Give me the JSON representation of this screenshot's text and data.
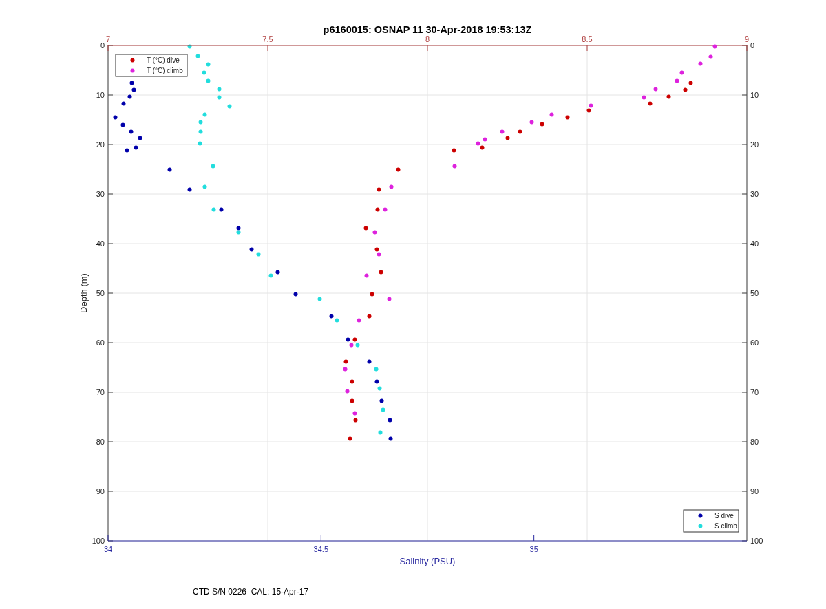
{
  "title": "p6160015: OSNAP 11 30-Apr-2018 19:53:13Z",
  "salinity_chart": {
    "chart_data": {
      "type": "scatter",
      "xlabel": "Salinity (PSU)",
      "ylabel": "Depth (m)",
      "xlim": [
        34,
        35.5
      ],
      "ylim": [
        100,
        0
      ],
      "legend": "lower right",
      "grid": true,
      "xticks": [
        34,
        34.5,
        35
      ],
      "yticks": [
        0,
        10,
        20,
        30,
        40,
        50,
        60,
        70,
        80,
        90,
        100
      ],
      "x": [
        34.055,
        34.06,
        34.05,
        34.035,
        34.016,
        34.034,
        34.053,
        34.074,
        34.065,
        34.044,
        34.144,
        34.19,
        34.265,
        34.305,
        34.337,
        34.398,
        34.44,
        34.524,
        34.563,
        34.613,
        34.631,
        34.642,
        34.661,
        34.663,
        34.19,
        34.21,
        34.235,
        34.224,
        34.235,
        34.261,
        34.261,
        34.284,
        34.226,
        34.216,
        34.216,
        34.215,
        34.245,
        34.226,
        34.247,
        34.306,
        34.352,
        34.381,
        34.497,
        34.537,
        34.585,
        34.629,
        34.637,
        34.645,
        34.639
      ],
      "series": [
        {
          "name": "S dive",
          "color": "#0000aa",
          "values": [
            7.5,
            8.9,
            10.3,
            11.7,
            14.4,
            16.0,
            17.4,
            18.6,
            20.6,
            21.1,
            25.0,
            29.0,
            33.1,
            36.8,
            41.1,
            45.7,
            50.1,
            54.6,
            59.3,
            63.8,
            67.8,
            71.7,
            75.6,
            79.3,
            null,
            null,
            null,
            null,
            null,
            null,
            null,
            null,
            null,
            null,
            null,
            null,
            null,
            null,
            null,
            null,
            null,
            null,
            null,
            null,
            null,
            null,
            null,
            null,
            null
          ]
        },
        {
          "name": "S climb",
          "color": "#22dddd",
          "values": [
            null,
            null,
            null,
            null,
            null,
            null,
            null,
            null,
            null,
            null,
            null,
            null,
            null,
            null,
            null,
            null,
            null,
            null,
            null,
            null,
            null,
            null,
            null,
            null,
            0.1,
            2.1,
            3.8,
            5.4,
            7.1,
            8.8,
            10.4,
            12.2,
            13.9,
            15.4,
            17.4,
            19.7,
            24.3,
            28.5,
            33.1,
            37.6,
            42.1,
            46.4,
            51.1,
            55.4,
            60.4,
            65.3,
            69.2,
            73.5,
            78.1
          ]
        }
      ]
    },
    "left_axis_labels": [
      "0",
      "10",
      "20",
      "30",
      "40",
      "50",
      "60",
      "70",
      "80",
      "90",
      "100"
    ],
    "right_axis_labels": [
      "0",
      "10",
      "20",
      "30",
      "40",
      "50",
      "60",
      "70",
      "80",
      "90",
      "100"
    ]
  },
  "temperature_chart": {
    "chart_data": {
      "type": "scatter",
      "xlim": [
        7,
        9
      ],
      "ylim": [
        100,
        0
      ],
      "legend": "upper left",
      "xticks": [
        7,
        7.5,
        8,
        8.5,
        9
      ],
      "x": [
        8.823,
        8.806,
        8.754,
        8.696,
        8.504,
        8.438,
        8.358,
        8.289,
        8.25,
        8.17,
        8.082,
        7.907,
        7.847,
        7.843,
        7.806,
        7.841,
        7.853,
        7.825,
        7.817,
        7.772,
        7.744,
        7.763,
        7.763,
        7.774,
        7.756,
        8.899,
        8.886,
        8.853,
        8.795,
        8.78,
        8.713,
        8.677,
        8.511,
        8.388,
        8.325,
        8.233,
        8.179,
        8.157,
        8.084,
        7.886,
        7.866,
        7.834,
        7.847,
        7.808,
        7.879,
        7.784,
        7.761,
        7.741,
        7.748,
        7.772
      ],
      "series": [
        {
          "name": "T (°C) dive",
          "color": "#cc0000",
          "values": [
            7.5,
            8.9,
            10.3,
            11.7,
            13.0,
            14.4,
            15.8,
            17.4,
            18.6,
            20.6,
            21.1,
            25.0,
            29.0,
            33.1,
            36.8,
            41.1,
            45.7,
            50.1,
            54.6,
            59.3,
            63.8,
            67.8,
            71.7,
            75.6,
            79.3,
            null,
            null,
            null,
            null,
            null,
            null,
            null,
            null,
            null,
            null,
            null,
            null,
            null,
            null,
            null,
            null,
            null,
            null,
            null,
            null,
            null,
            null,
            null,
            null,
            null
          ]
        },
        {
          "name": "T (°C) climb",
          "color": "#dd22dd",
          "values": [
            null,
            null,
            null,
            null,
            null,
            null,
            null,
            null,
            null,
            null,
            null,
            null,
            null,
            null,
            null,
            null,
            null,
            null,
            null,
            null,
            null,
            null,
            null,
            null,
            null,
            0.1,
            2.2,
            3.6,
            5.4,
            7.1,
            8.8,
            10.4,
            12.1,
            13.9,
            15.4,
            17.4,
            18.9,
            19.7,
            24.3,
            28.5,
            33.1,
            37.6,
            42.1,
            46.4,
            51.1,
            55.4,
            60.4,
            65.3,
            69.7,
            74.2
          ]
        }
      ]
    }
  },
  "footer": "CTD S/N 0226  CAL: 15-Apr-17"
}
